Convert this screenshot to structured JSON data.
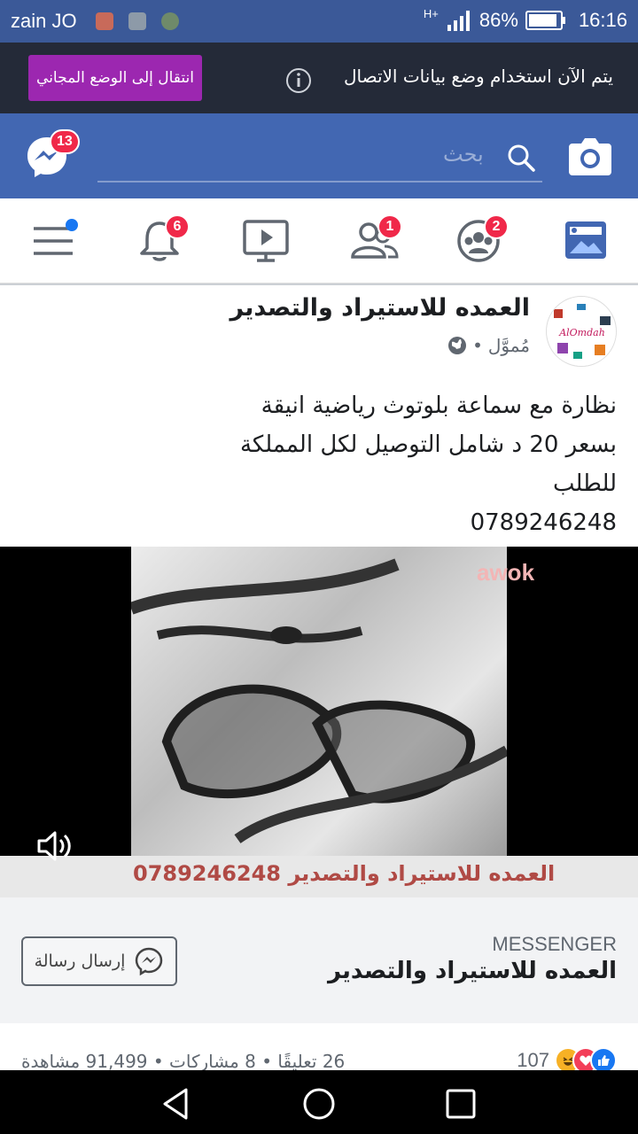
{
  "status_bar": {
    "carrier": "zain JO",
    "network": "H+",
    "battery": "86%",
    "time": "16:16"
  },
  "data_notice": {
    "text": "يتم الآن استخدام وضع بيانات الاتصال",
    "button_label": "انتقال إلى الوضع المجاني"
  },
  "header": {
    "search_placeholder": "بحث",
    "messenger_badge": "13"
  },
  "tabs": {
    "groups_badge": "2",
    "friends_badge": "1",
    "notifications_badge": "6"
  },
  "post": {
    "page_name": "العمده للاستيراد والتصدير",
    "sponsored": "مُموَّل",
    "avatar_text": "AlOmdah",
    "text_lines": [
      "نظارة مع سماعة بلوتوث رياضية انيقة",
      "بسعر 20 د شامل التوصيل لكل المملكة",
      "للطلب",
      "0789246248"
    ],
    "video_caption": "العمده للاستيراد والتصدير 0789246248",
    "video_watermark": "awok"
  },
  "cta": {
    "label": "MESSENGER",
    "title": "العمده للاستيراد والتصدير",
    "button": "إرسال رسالة"
  },
  "stats": {
    "reactions_count": "107",
    "summary": "26 تعليقًا • 8 مشاركات • 91,499 مشاهدة"
  },
  "colors": {
    "facebook_blue": "#4267b2",
    "status_blue": "#3b5998",
    "notice_bg": "#242a38",
    "free_mode_purple": "#9c27b0",
    "badge_red": "#f02849"
  }
}
